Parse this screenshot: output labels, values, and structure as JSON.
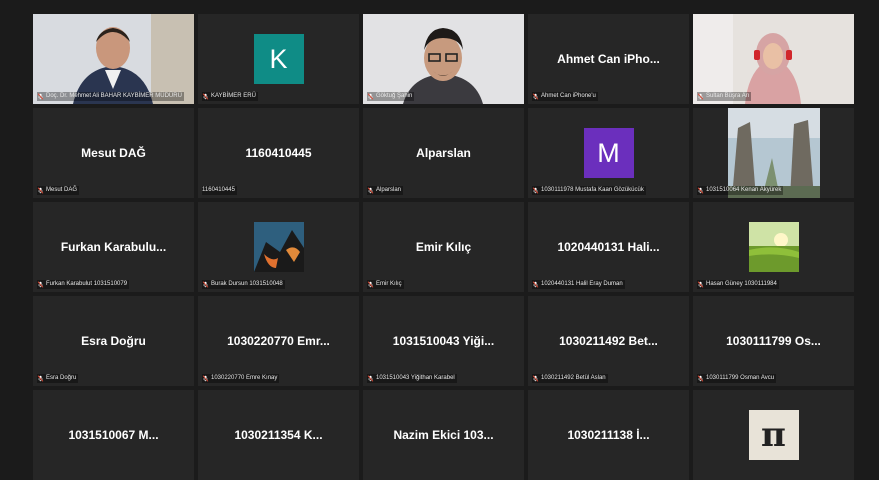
{
  "participants": [
    {
      "display": "",
      "label": "Doç. Dr. Mehmet Ali BAHAR KAYBİMER MÜDÜRÜ",
      "kind": "photo-man"
    },
    {
      "display": "",
      "label": "KAYBİMER ERÜ",
      "kind": "letter",
      "letter": "K",
      "color": "#0f8c86"
    },
    {
      "display": "",
      "label": "Göktuğ Şahin",
      "kind": "photo-glasses"
    },
    {
      "display": "Ahmet Can iPho...",
      "label": "Ahmet Can iPhone'u",
      "kind": "name"
    },
    {
      "display": "",
      "label": "Sultan Büşra Arı",
      "kind": "photo-woman"
    },
    {
      "display": "Mesut DAĞ",
      "label": "Mesut DAĞ",
      "kind": "name"
    },
    {
      "display": "1160410445",
      "label": "1160410445",
      "kind": "name",
      "noMic": true
    },
    {
      "display": "Alparslan",
      "label": "Alparslan",
      "kind": "name"
    },
    {
      "display": "",
      "label": "1030111978 Mustafa Kaan Gözükücük",
      "kind": "letter",
      "letter": "M",
      "color": "#6b2fbd"
    },
    {
      "display": "",
      "label": "1031510064 Kenan Akyürek",
      "kind": "photo-statues"
    },
    {
      "display": "Furkan Karabulu...",
      "label": "Furkan Karabulut 1031510079",
      "kind": "name"
    },
    {
      "display": "",
      "label": "Burak Dursun 1031510048",
      "kind": "photo-abstract"
    },
    {
      "display": "Emir Kılıç",
      "label": "Emir Kılıç",
      "kind": "name"
    },
    {
      "display": "1020440131 Hali...",
      "label": "1020440131 Halil Eray Duman",
      "kind": "name"
    },
    {
      "display": "",
      "label": "Hasan Güney 1030111984",
      "kind": "photo-landscape"
    },
    {
      "display": "Esra Doğru",
      "label": "Esra Doğru",
      "kind": "name"
    },
    {
      "display": "1030220770 Emr...",
      "label": "1030220770 Emre Kınay",
      "kind": "name"
    },
    {
      "display": "1031510043 Yiği...",
      "label": "1031510043 Yiğithan Karabel",
      "kind": "name"
    },
    {
      "display": "1030211492 Bet...",
      "label": "1030211492 Betül Aslan",
      "kind": "name"
    },
    {
      "display": "1030111799 Os...",
      "label": "1030111799 Osman Avcu",
      "kind": "name"
    },
    {
      "display": "1031510067 M...",
      "label": "",
      "kind": "name"
    },
    {
      "display": "1030211354 K...",
      "label": "",
      "kind": "name"
    },
    {
      "display": "Nazim Ekici 103...",
      "label": "",
      "kind": "name"
    },
    {
      "display": "1030211138 İ...",
      "label": "",
      "kind": "name"
    },
    {
      "display": "",
      "label": "",
      "kind": "photo-pi"
    }
  ],
  "colors": {
    "mic_muted": "#e0452f",
    "active_border": "#8ed14b"
  }
}
